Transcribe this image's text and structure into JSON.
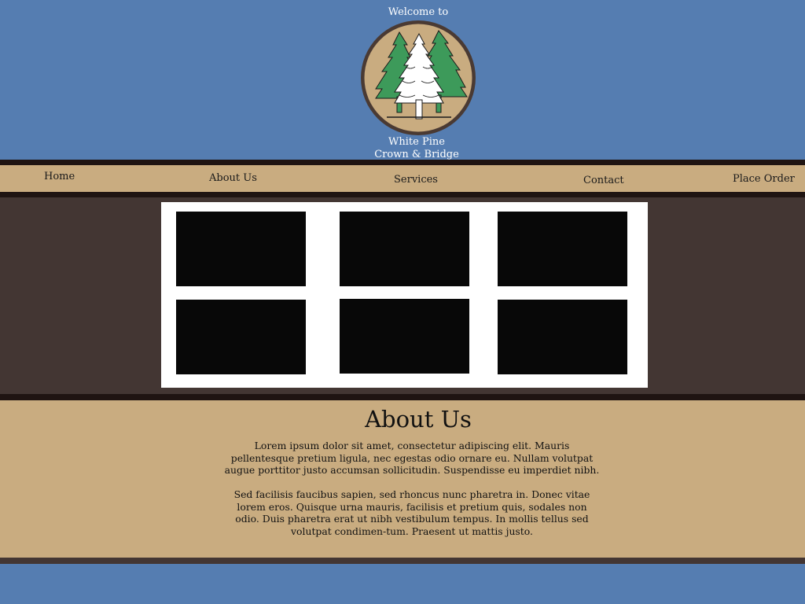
{
  "header": {
    "welcome": "Welcome to",
    "business_name_line1": "White Pine",
    "business_name_line2": "Crown & Bridge",
    "logo_icon": "pine-trees-logo-icon"
  },
  "nav": {
    "items": [
      {
        "label": "Home"
      },
      {
        "label": "About Us"
      },
      {
        "label": "Services"
      },
      {
        "label": "Contact"
      },
      {
        "label": "Place Order"
      }
    ]
  },
  "gallery": {
    "thumbnail_count": 6
  },
  "about": {
    "title": "About Us",
    "paragraph1": "Lorem ipsum dolor sit amet, consectetur adipiscing elit. Mauris pellentesque pretium ligula, nec egestas odio ornare eu. Nullam volutpat augue porttitor justo accumsan sollicitudin. Suspendisse eu imperdiet nibh.",
    "paragraph2": "Sed facilisis faucibus sapien, sed rhoncus nunc pharetra in. Donec vitae lorem eros. Quisque urna mauris, facilisis et pretium quis, sodales non odio. Duis pharetra erat ut nibh vestibulum tempus. In mollis tellus sed volutpat condimen-tum. Praesent ut mattis justo."
  },
  "colors": {
    "sky_blue": "#557db1",
    "tan": "#c9ac80",
    "dark_brown": "#1f1412",
    "mid_brown": "#433633",
    "pine_green": "#3d9a5a"
  }
}
